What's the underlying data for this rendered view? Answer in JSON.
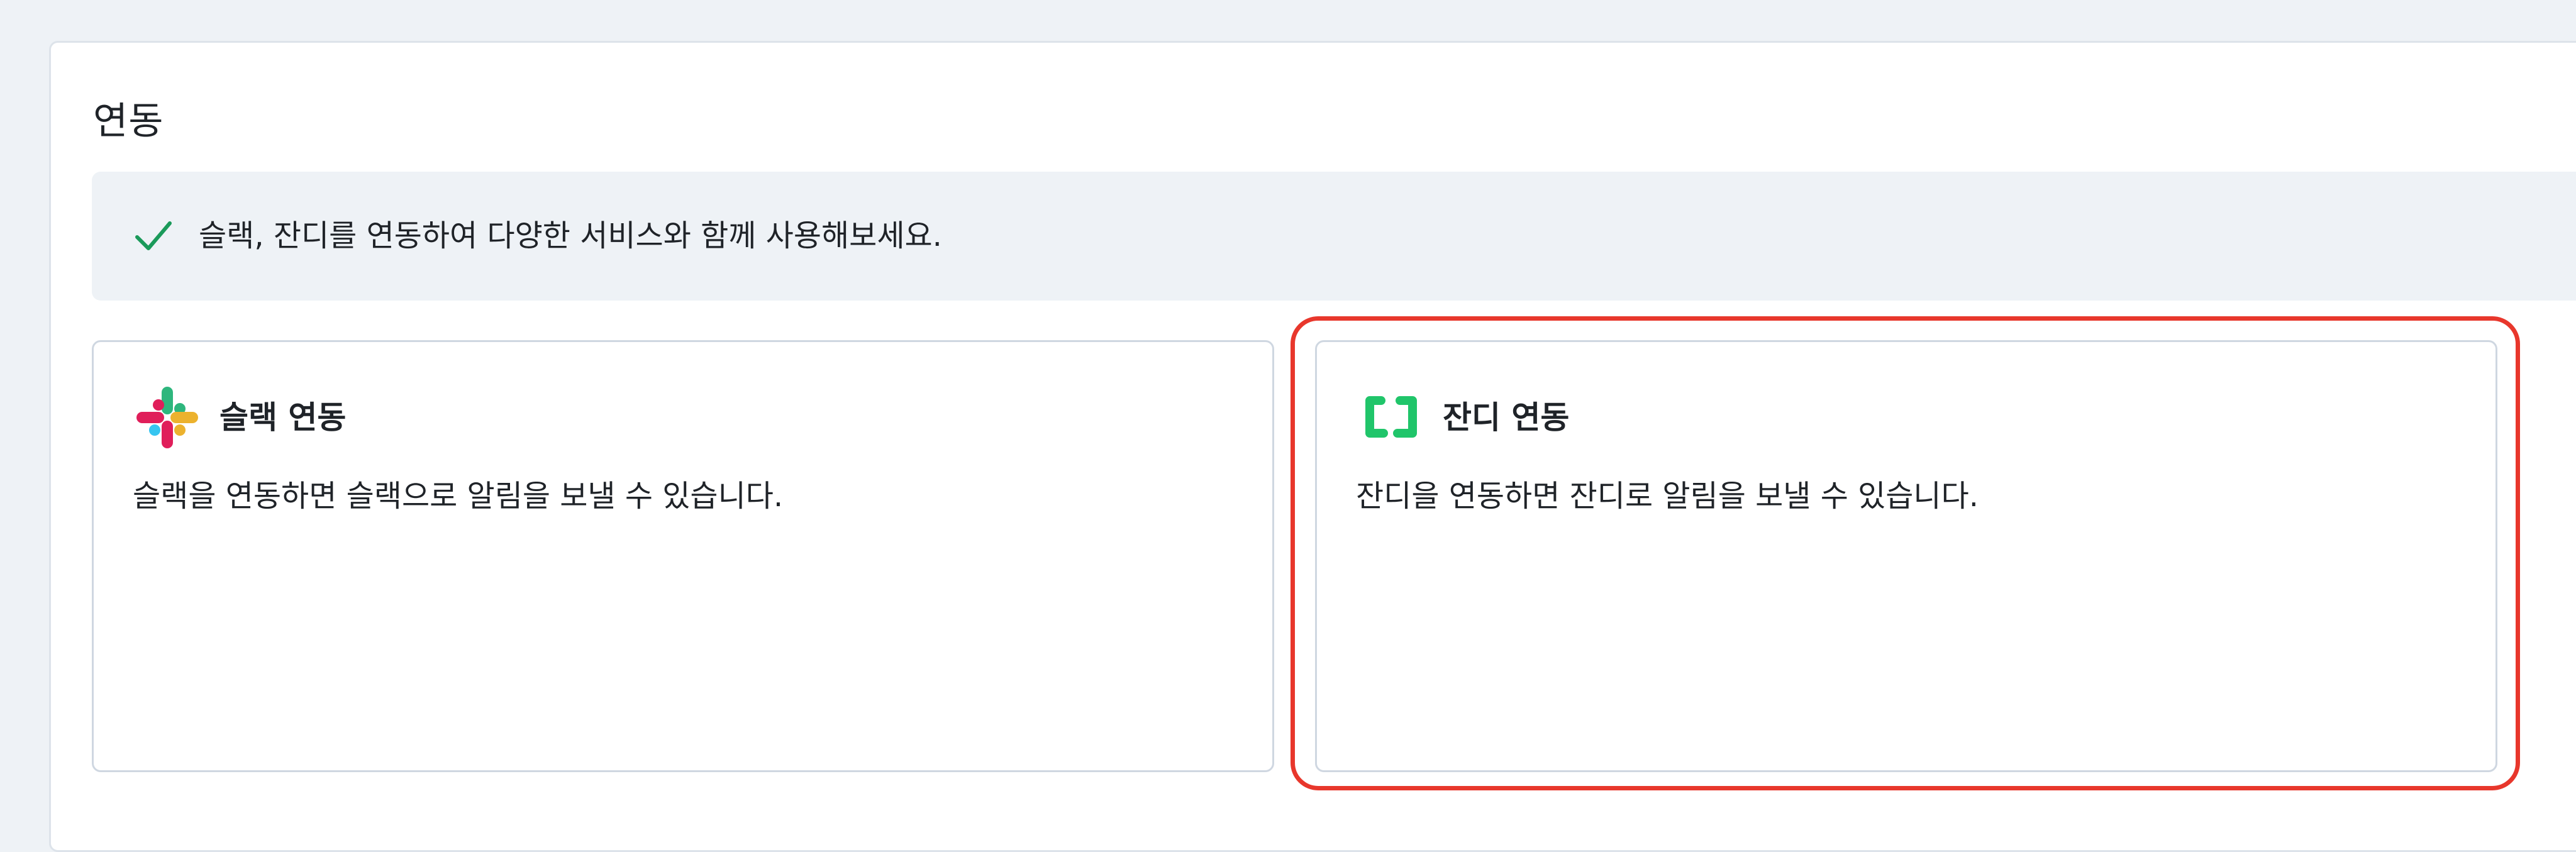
{
  "integration": {
    "title": "연동",
    "notice": {
      "icon": "check-icon",
      "text": "슬랙, 잔디를 연동하여 다양한 서비스와 함께 사용해보세요."
    },
    "cards": [
      {
        "id": "slack",
        "icon": "slack-logo-icon",
        "title": "슬랙 연동",
        "description": "슬랙을 연동하면 슬랙으로 알림을 보낼 수 있습니다."
      },
      {
        "id": "jandi",
        "icon": "jandi-logo-icon",
        "title": "잔디 연동",
        "description": "잔디을 연동하면 잔디로 알림을 보낼 수 있습니다."
      }
    ]
  },
  "colors": {
    "page_background": "#eef2f6",
    "card_border": "#cfd7e1",
    "check": "#1a9a5a",
    "jandi_green": "#20c56a",
    "highlight": "#e8372c",
    "slack_red": "#e01e5a",
    "slack_blue": "#36c5f0",
    "slack_green": "#2eb67d",
    "slack_yellow": "#ecb22e"
  }
}
